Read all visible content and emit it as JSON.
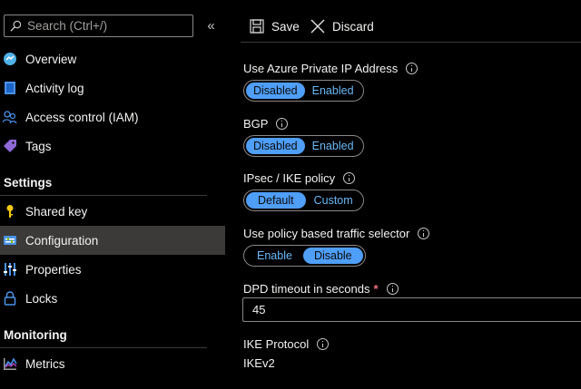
{
  "search": {
    "placeholder": "Search (Ctrl+/)"
  },
  "nav": {
    "overview": "Overview",
    "activity_log": "Activity log",
    "access_control": "Access control (IAM)",
    "tags": "Tags",
    "settings_header": "Settings",
    "shared_key": "Shared key",
    "configuration": "Configuration",
    "properties": "Properties",
    "locks": "Locks",
    "monitoring_header": "Monitoring",
    "metrics": "Metrics"
  },
  "toolbar": {
    "save_label": "Save",
    "discard_label": "Discard"
  },
  "form": {
    "private_ip": {
      "label": "Use Azure Private IP Address",
      "options": [
        "Disabled",
        "Enabled"
      ],
      "selected": "Disabled"
    },
    "bgp": {
      "label": "BGP",
      "options": [
        "Disabled",
        "Enabled"
      ],
      "selected": "Disabled"
    },
    "ipsec": {
      "label": "IPsec / IKE policy",
      "options": [
        "Default",
        "Custom"
      ],
      "selected": "Default"
    },
    "policy_selector": {
      "label": "Use policy based traffic selector",
      "options": [
        "Enable",
        "Disable"
      ],
      "selected": "Disable"
    },
    "dpd": {
      "label": "DPD timeout in seconds",
      "required_mark": "*",
      "value": "45"
    },
    "ike": {
      "label": "IKE Protocol",
      "value": "IKEv2"
    }
  },
  "colors": {
    "accent": "#4f9ef8",
    "link": "#6cb8f6",
    "selected_nav": "#3b3a39",
    "required": "#f1707b"
  }
}
